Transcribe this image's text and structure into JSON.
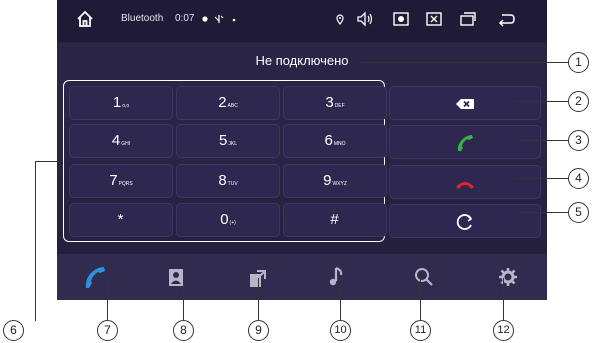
{
  "statusbar": {
    "title": "Bluetooth",
    "time": "0:07",
    "icons": [
      "home-icon",
      "dot-icon",
      "signal-icon",
      "dot-small-icon",
      "location-icon",
      "volume-icon",
      "screenshot-icon",
      "close-box-icon",
      "windows-icon",
      "back-icon"
    ]
  },
  "status": {
    "text": "Не подключено"
  },
  "keypad": {
    "keys": [
      {
        "main": "1",
        "sub": "o,o"
      },
      {
        "main": "2",
        "sub": "ABC"
      },
      {
        "main": "3",
        "sub": "DEF"
      },
      {
        "main": "4",
        "sub": "GHI"
      },
      {
        "main": "5",
        "sub": "JKL"
      },
      {
        "main": "6",
        "sub": "MNO"
      },
      {
        "main": "7",
        "sub": "PQRS"
      },
      {
        "main": "8",
        "sub": "TUV"
      },
      {
        "main": "9",
        "sub": "WXYZ"
      },
      {
        "main": "*",
        "sub": ""
      },
      {
        "main": "0",
        "sub": "(+)"
      },
      {
        "main": "#",
        "sub": ""
      }
    ]
  },
  "actions": [
    "backspace-icon",
    "call-icon",
    "hangup-icon",
    "refresh-icon"
  ],
  "bottom": [
    "phone-icon",
    "contacts-icon",
    "call-transfer-icon",
    "music-icon",
    "search-icon",
    "settings-icon"
  ],
  "callouts": [
    "1",
    "2",
    "3",
    "4",
    "5",
    "6",
    "7",
    "8",
    "9",
    "10",
    "11",
    "12"
  ],
  "colors": {
    "background": "#2a2446",
    "call": "#35b34a",
    "hangup": "#e5232b",
    "accent": "#2f8fdc"
  }
}
